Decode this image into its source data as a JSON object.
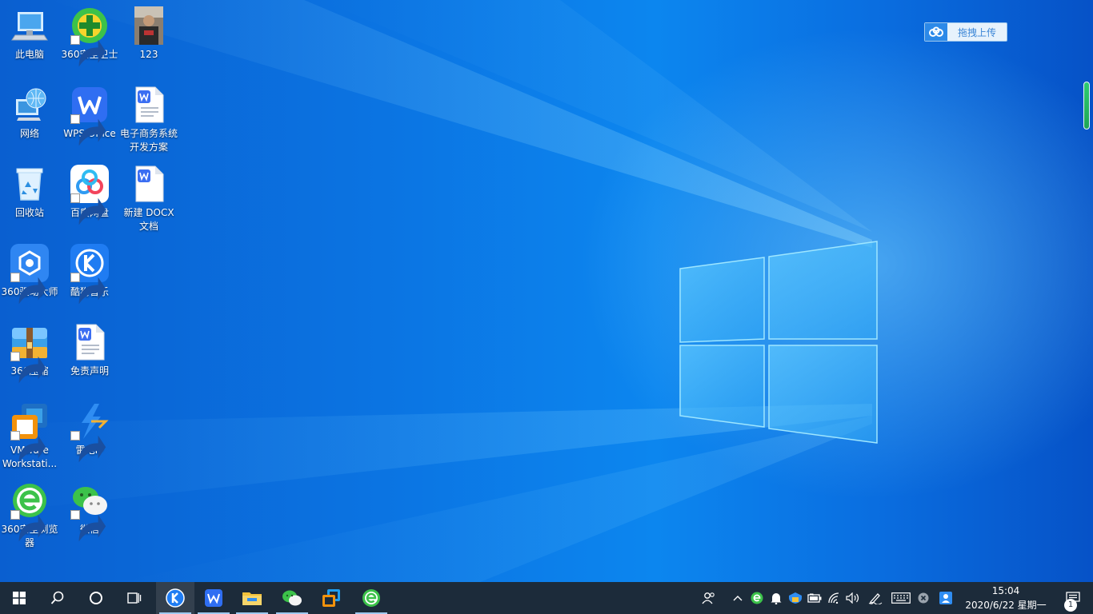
{
  "desktop": {
    "icons": [
      {
        "label": "此电脑"
      },
      {
        "label": "360安全卫士"
      },
      {
        "label": "123"
      },
      {
        "label": "网络"
      },
      {
        "label": "WPS Office"
      },
      {
        "label": "电子商务系统开发方案"
      },
      {
        "label": "回收站"
      },
      {
        "label": "百度网盘"
      },
      {
        "label": "新建 DOCX 文档"
      },
      {
        "label": "360驱动大师"
      },
      {
        "label": "酷狗音乐"
      },
      {
        "label": "360压缩"
      },
      {
        "label": "免责声明"
      },
      {
        "label": "VMware Workstati..."
      },
      {
        "label": "雷电IP"
      },
      {
        "label": "360安全浏览器"
      },
      {
        "label": "微信"
      }
    ]
  },
  "upload_widget": {
    "label": "拖拽上传"
  },
  "taskbar": {
    "apps": [
      "kugou-music",
      "wps-office",
      "file-explorer",
      "wechat",
      "vmware",
      "360-browser"
    ],
    "clock": {
      "time": "15:04",
      "date": "2020/6/22 星期一"
    },
    "notification_count": "1"
  },
  "colors": {
    "taskbar": "#1c2b3a",
    "desktop_accent": "#0b74e2"
  }
}
